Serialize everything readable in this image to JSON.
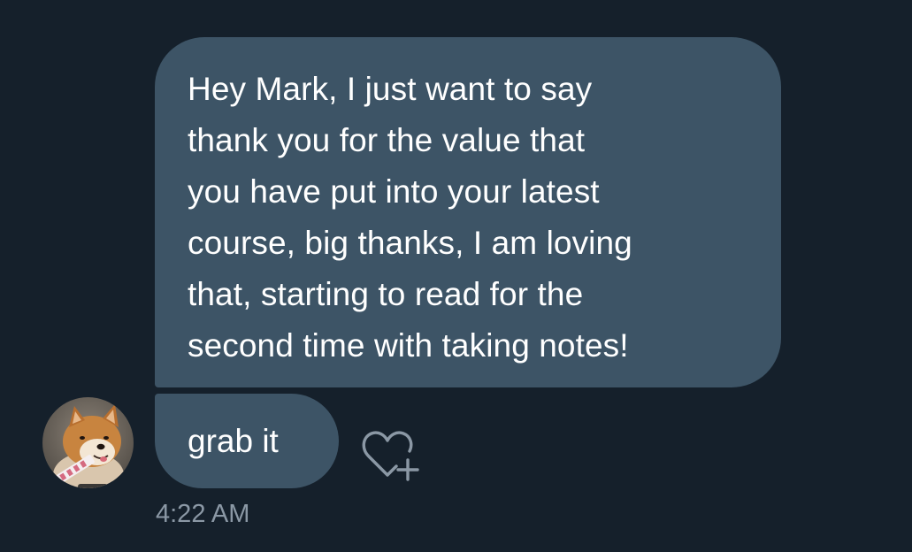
{
  "conversation": {
    "message_main": {
      "lines": [
        "Hey Mark, I just want to say",
        "thank you for the value that",
        "you have put into your latest",
        "course, big thanks, I am loving",
        "that, starting to read for the",
        "second time with taking notes!"
      ]
    },
    "message_short": {
      "text": "grab it"
    },
    "timestamp": "4:22 AM",
    "avatar": {
      "icon": "dog-avatar"
    },
    "reaction": {
      "icon": "heart-plus-icon"
    }
  },
  "colors": {
    "background": "#15202b",
    "bubble": "#3d5466",
    "text": "#ffffff",
    "muted": "#8b98a5"
  }
}
